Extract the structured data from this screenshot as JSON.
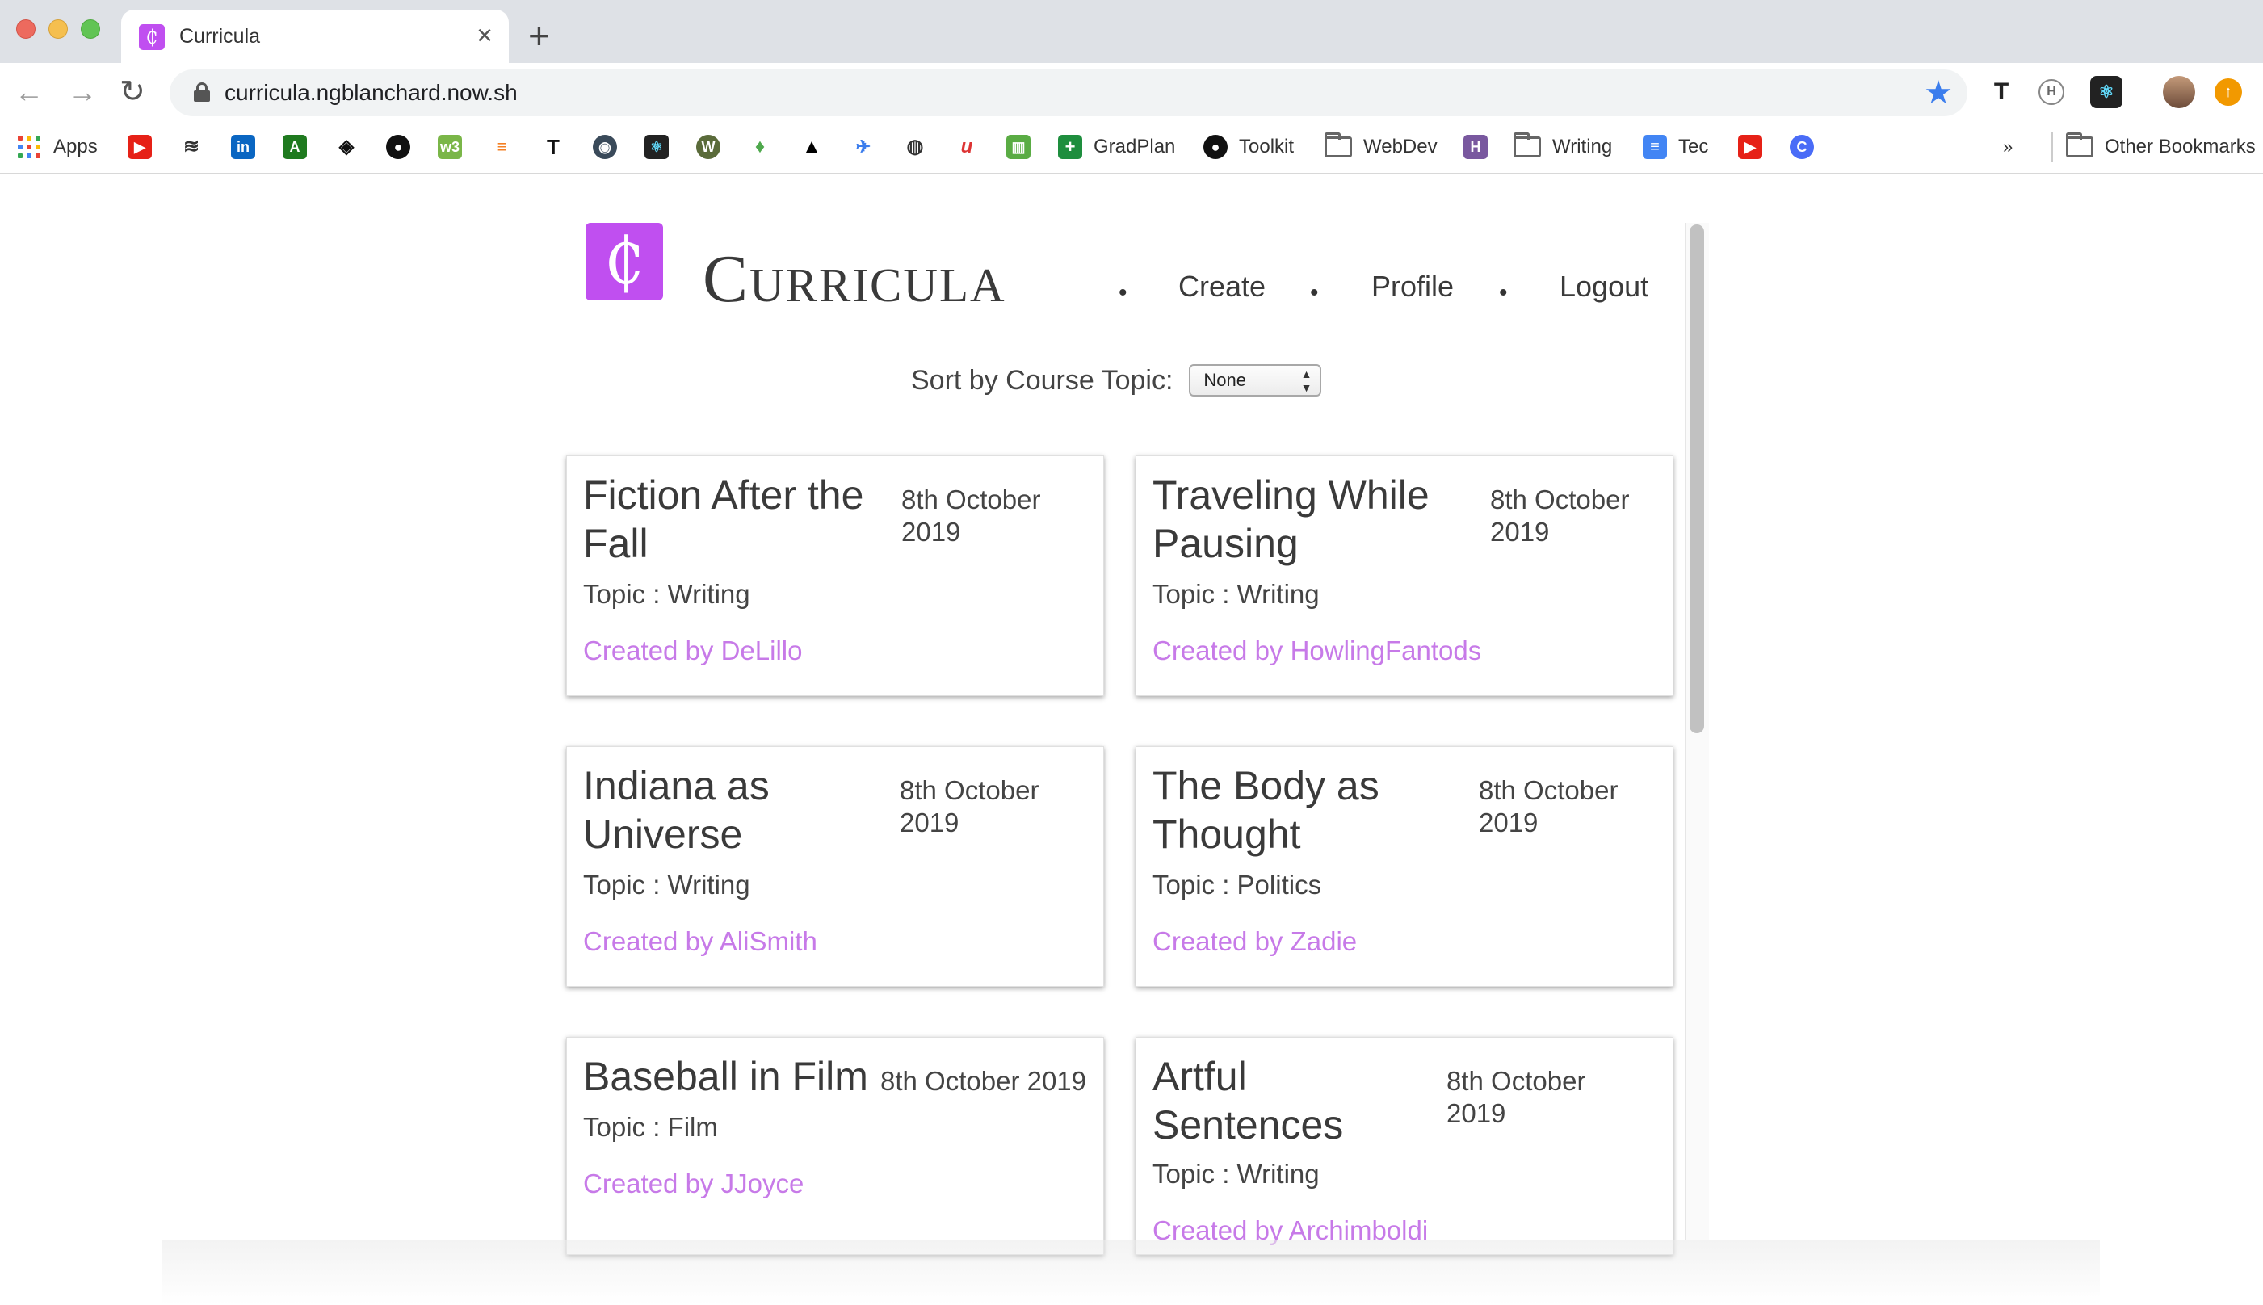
{
  "browser": {
    "tab_title": "Curricula",
    "tab_favicon_glyph": "₵",
    "url": "curricula.ngblanchard.now.sh",
    "bookmarks": {
      "apps": "Apps",
      "gradplan": "GradPlan",
      "toolkit": "Toolkit",
      "webdev": "WebDev",
      "writing": "Writing",
      "tec": "Tec",
      "other": "Other Bookmarks",
      "overflow": "»"
    },
    "accent_color": "#3b7ded"
  },
  "app": {
    "logo_glyph": "₵",
    "brand": "Curricula",
    "brand_color": "#c04ff0",
    "nav": {
      "create": "Create",
      "profile": "Profile",
      "logout": "Logout",
      "separator": "•"
    },
    "sort": {
      "label": "Sort by Course Topic:",
      "selected": "None"
    },
    "courses": [
      {
        "title": "Fiction After the Fall",
        "date": "8th October 2019",
        "topic": "Topic : Writing",
        "author": "Created by DeLillo"
      },
      {
        "title": "Traveling While Pausing",
        "date": "8th October 2019",
        "topic": "Topic : Writing",
        "author": "Created by HowlingFantods"
      },
      {
        "title": "Indiana as Universe",
        "date": "8th October 2019",
        "topic": "Topic : Writing",
        "author": "Created by AliSmith"
      },
      {
        "title": "The Body as Thought",
        "date": "8th October 2019",
        "topic": "Topic : Politics",
        "author": "Created by Zadie"
      },
      {
        "title": "Baseball in Film",
        "date": "8th October 2019",
        "topic": "Topic : Film",
        "author": "Created by JJoyce"
      },
      {
        "title": "Artful Sentences",
        "date": "8th October 2019",
        "topic": "Topic : Writing",
        "author": "Created by Archimboldi"
      }
    ],
    "author_color": "#c77ae8"
  }
}
